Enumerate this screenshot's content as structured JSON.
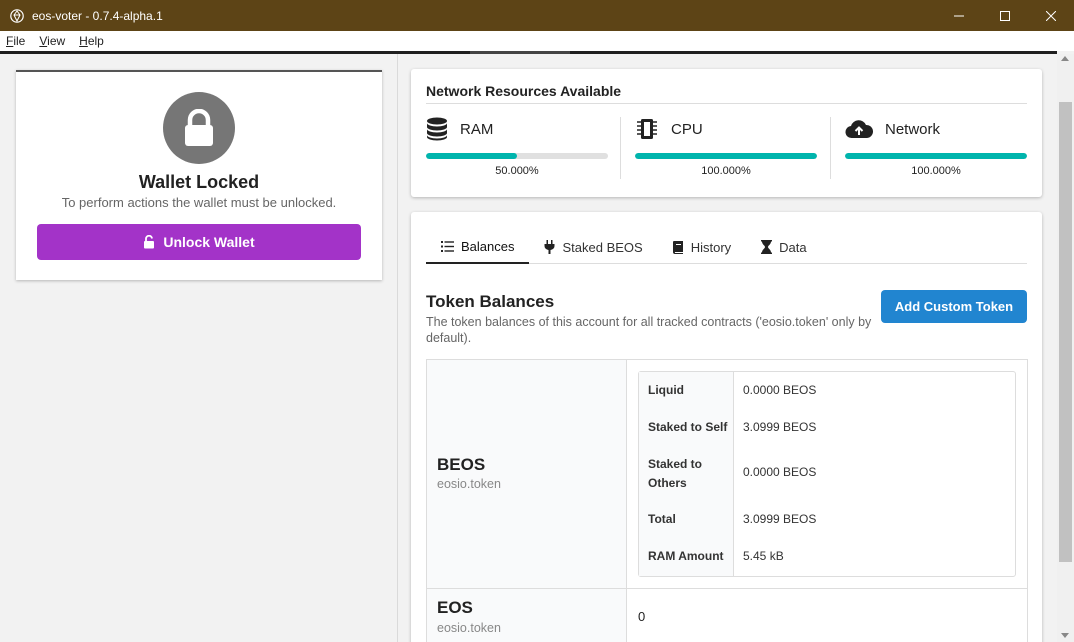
{
  "window": {
    "title": "eos-voter - 0.7.4-alpha.1"
  },
  "menu": [
    "File",
    "View",
    "Help"
  ],
  "wallet": {
    "title": "Wallet Locked",
    "subtitle": "To perform actions the wallet must be unlocked.",
    "unlock_label": "Unlock Wallet"
  },
  "network": {
    "title": "Network Resources Available",
    "resources": [
      {
        "name": "RAM",
        "percent_label": "50.000%",
        "fraction": 0.5,
        "icon": "database-icon"
      },
      {
        "name": "CPU",
        "percent_label": "100.000%",
        "fraction": 1.0,
        "icon": "microchip-icon"
      },
      {
        "name": "Network",
        "percent_label": "100.000%",
        "fraction": 1.0,
        "icon": "cloud-upload-icon"
      }
    ]
  },
  "tabs": [
    {
      "label": "Balances",
      "icon": "list-icon",
      "active": true
    },
    {
      "label": "Staked BEOS",
      "icon": "plug-icon",
      "active": false
    },
    {
      "label": "History",
      "icon": "book-icon",
      "active": false
    },
    {
      "label": "Data",
      "icon": "hourglass-icon",
      "active": false
    }
  ],
  "balances": {
    "title": "Token Balances",
    "subtitle": "The token balances of this account for all tracked contracts ('eosio.token' only by default).",
    "add_label": "Add Custom Token",
    "tokens": [
      {
        "symbol": "BEOS",
        "contract": "eosio.token",
        "rows": [
          {
            "label": "Liquid",
            "value": "0.0000 BEOS"
          },
          {
            "label": "Staked to Self",
            "value": "3.0999 BEOS"
          },
          {
            "label": "Staked to Others",
            "value": "0.0000 BEOS"
          },
          {
            "label": "Total",
            "value": "3.0999 BEOS"
          },
          {
            "label": "RAM Amount",
            "value": "5.45 kB"
          }
        ]
      },
      {
        "symbol": "EOS",
        "contract": "eosio.token",
        "value": "0"
      }
    ]
  },
  "colors": {
    "titlebar": "#5d4416",
    "unlock_button": "#a333c8",
    "add_button": "#2185d0",
    "progress_fill": "#00b5ad"
  }
}
